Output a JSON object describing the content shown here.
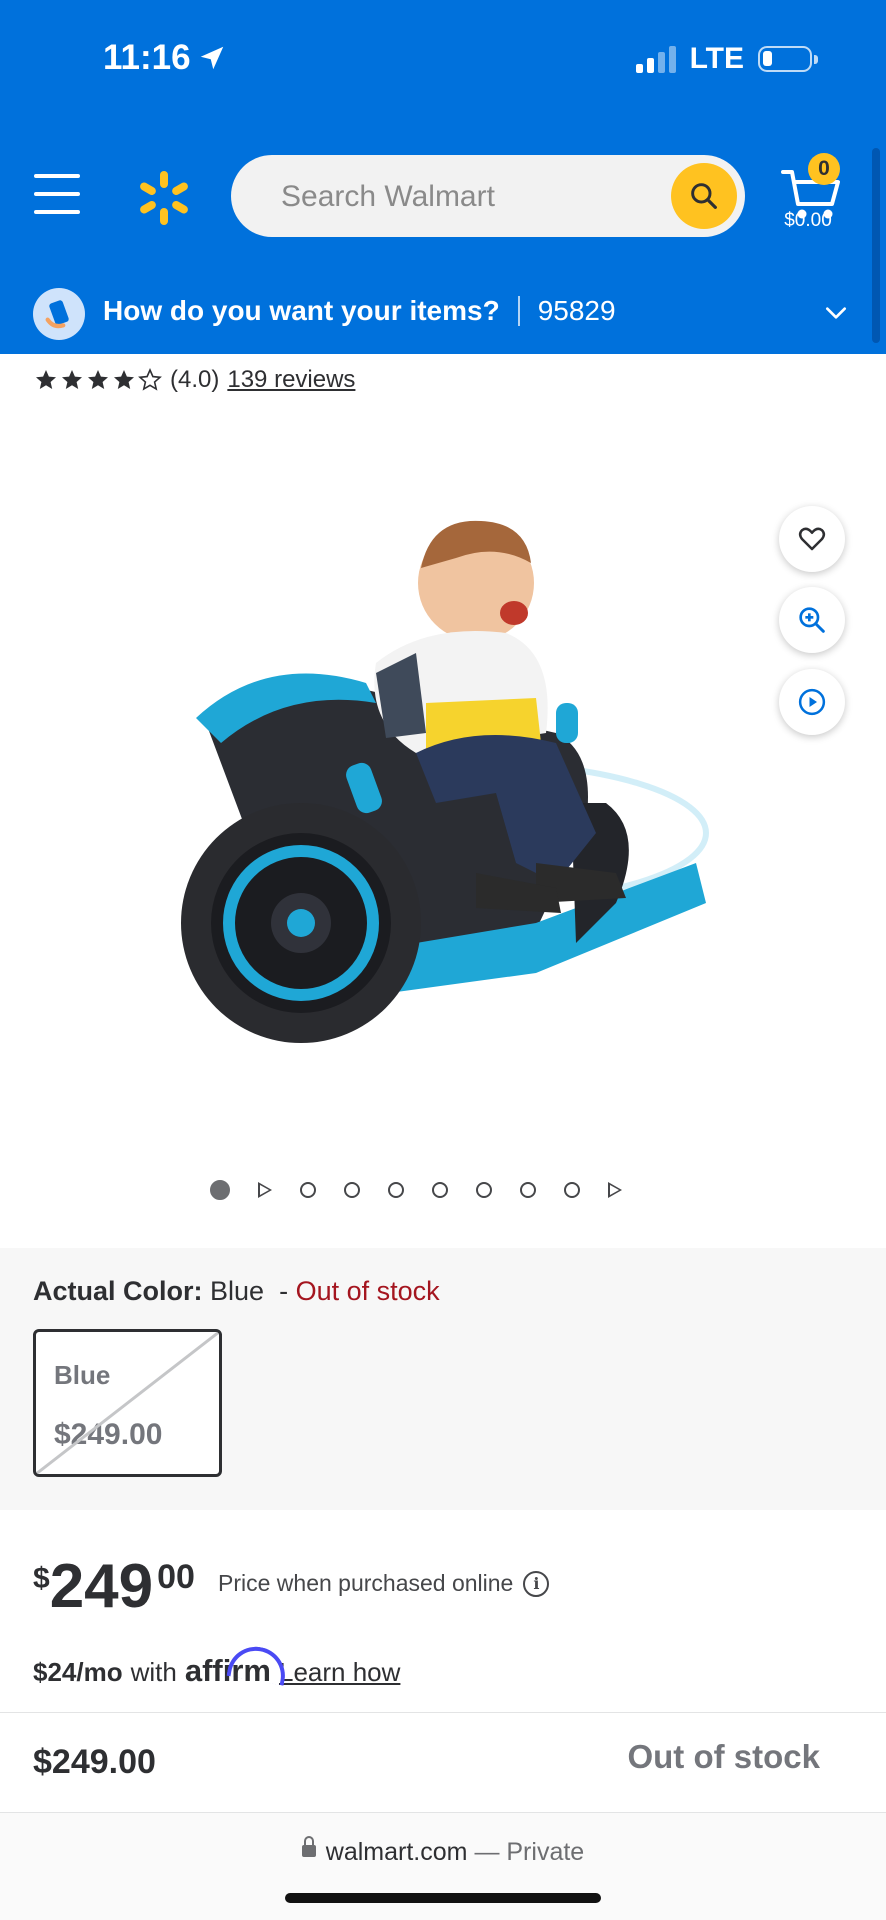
{
  "status_bar": {
    "time": "11:16",
    "network": "LTE"
  },
  "header": {
    "search_placeholder": "Search Walmart",
    "cart_count": "0",
    "cart_total": "$0.00"
  },
  "location": {
    "prompt": "How do you want your items?",
    "zip": "95829"
  },
  "product": {
    "rating_value": "(4.0)",
    "reviews_label": "139 reviews",
    "image_description": "Blue Power Wheels Wild Thing ride-on with child",
    "carousel_count": 10
  },
  "variant": {
    "label": "Actual Color:",
    "value": "Blue",
    "separator": "-",
    "stock_status": "Out of stock",
    "swatch_name": "Blue",
    "swatch_price": "$249.00"
  },
  "price": {
    "currency": "$",
    "dollars": "249",
    "cents": "00",
    "note": "Price when purchased online",
    "info_icon_text": "i"
  },
  "affirm": {
    "monthly": "$24/mo",
    "with": "with",
    "brand": "affirm",
    "learn_link": "Learn how"
  },
  "bottom_bar": {
    "price": "$249.00",
    "status": "Out of stock"
  },
  "browser": {
    "domain": "walmart.com",
    "privacy": "— Private"
  },
  "colors": {
    "brand_blue": "#0071dc",
    "spark_yellow": "#ffc220",
    "out_of_stock_red": "#a4151f"
  }
}
